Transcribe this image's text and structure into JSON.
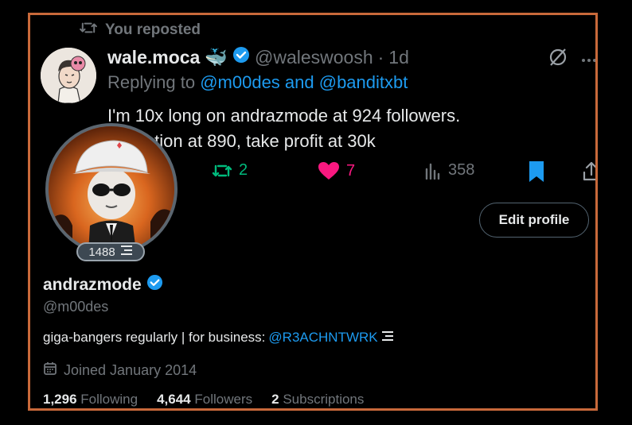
{
  "repost": {
    "label": "You reposted",
    "icon": "repost-icon"
  },
  "tweet": {
    "author_name": "wale.moca",
    "author_emoji": "🐳",
    "handle": "@waleswoosh",
    "separator": "·",
    "time": "1d",
    "reply_prefix": "Replying to",
    "reply_to": "@m00des and @banditxbt",
    "text_line1": "I'm 10x long on andrazmode at 924 followers.",
    "text_line2": "lation at 890, take profit at 30k",
    "retweets": "2",
    "likes": "7",
    "views": "358"
  },
  "profile": {
    "badge_number": "1488",
    "edit_label": "Edit profile",
    "display_name": "andrazmode",
    "handle": "@m00des",
    "bio_text": "giga-bangers regularly | for business:",
    "bio_link": "@R3ACHNTWRK",
    "joined": "Joined January 2014",
    "following_count": "1,296",
    "following_label": "Following",
    "followers_count": "4,644",
    "followers_label": "Followers",
    "subscriptions_count": "2",
    "subscriptions_label": "Subscriptions"
  },
  "colors": {
    "accent": "#1d9bf0",
    "retweet": "#00ba7c",
    "like": "#f91880",
    "frame": "#c8693a",
    "muted": "#71767b"
  }
}
